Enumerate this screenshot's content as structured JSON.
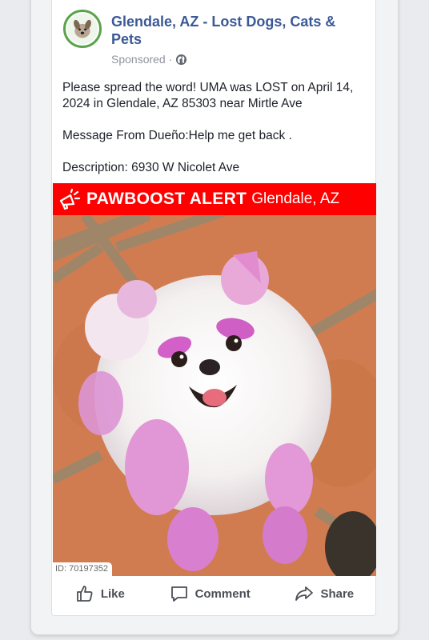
{
  "post": {
    "page_name": "Glendale, AZ - Lost Dogs, Cats & Pets",
    "sponsored_label": "Sponsored ·",
    "body": {
      "line1": "Please spread the word! UMA was LOST on April 14, 2024 in Glendale, AZ 85303 near Mirtle Ave",
      "line2": "Message From Dueño:Help me get back .",
      "line3": "Description: 6930 W Nicolet Ave"
    },
    "banner": {
      "brand": "PAWBOOST ALERT",
      "location": "Glendale, AZ",
      "color": "#ff0000"
    },
    "photo": {
      "id_label": "ID: 70197352"
    },
    "actions": {
      "like": "Like",
      "comment": "Comment",
      "share": "Share"
    }
  },
  "colors": {
    "page_name": "#3b5998",
    "meta_text": "#90949c",
    "background": "#e9ebee"
  }
}
